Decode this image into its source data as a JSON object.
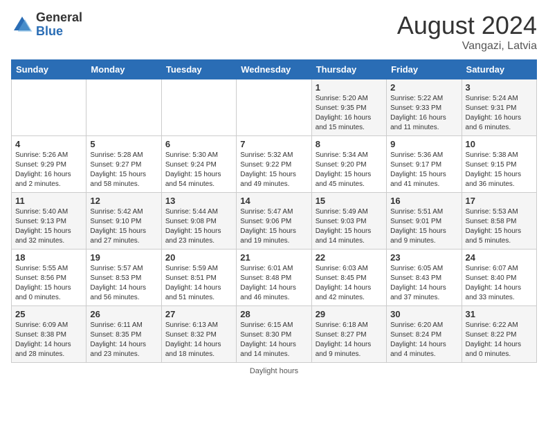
{
  "header": {
    "logo_general": "General",
    "logo_blue": "Blue",
    "month_year": "August 2024",
    "location": "Vangazi, Latvia"
  },
  "footer": {
    "note": "Daylight hours"
  },
  "days_of_week": [
    "Sunday",
    "Monday",
    "Tuesday",
    "Wednesday",
    "Thursday",
    "Friday",
    "Saturday"
  ],
  "weeks": [
    [
      {
        "day": "",
        "sunrise": "",
        "sunset": "",
        "daylight": ""
      },
      {
        "day": "",
        "sunrise": "",
        "sunset": "",
        "daylight": ""
      },
      {
        "day": "",
        "sunrise": "",
        "sunset": "",
        "daylight": ""
      },
      {
        "day": "",
        "sunrise": "",
        "sunset": "",
        "daylight": ""
      },
      {
        "day": "1",
        "sunrise": "5:20 AM",
        "sunset": "9:35 PM",
        "daylight": "16 hours and 15 minutes."
      },
      {
        "day": "2",
        "sunrise": "5:22 AM",
        "sunset": "9:33 PM",
        "daylight": "16 hours and 11 minutes."
      },
      {
        "day": "3",
        "sunrise": "5:24 AM",
        "sunset": "9:31 PM",
        "daylight": "16 hours and 6 minutes."
      }
    ],
    [
      {
        "day": "4",
        "sunrise": "5:26 AM",
        "sunset": "9:29 PM",
        "daylight": "16 hours and 2 minutes."
      },
      {
        "day": "5",
        "sunrise": "5:28 AM",
        "sunset": "9:27 PM",
        "daylight": "15 hours and 58 minutes."
      },
      {
        "day": "6",
        "sunrise": "5:30 AM",
        "sunset": "9:24 PM",
        "daylight": "15 hours and 54 minutes."
      },
      {
        "day": "7",
        "sunrise": "5:32 AM",
        "sunset": "9:22 PM",
        "daylight": "15 hours and 49 minutes."
      },
      {
        "day": "8",
        "sunrise": "5:34 AM",
        "sunset": "9:20 PM",
        "daylight": "15 hours and 45 minutes."
      },
      {
        "day": "9",
        "sunrise": "5:36 AM",
        "sunset": "9:17 PM",
        "daylight": "15 hours and 41 minutes."
      },
      {
        "day": "10",
        "sunrise": "5:38 AM",
        "sunset": "9:15 PM",
        "daylight": "15 hours and 36 minutes."
      }
    ],
    [
      {
        "day": "11",
        "sunrise": "5:40 AM",
        "sunset": "9:13 PM",
        "daylight": "15 hours and 32 minutes."
      },
      {
        "day": "12",
        "sunrise": "5:42 AM",
        "sunset": "9:10 PM",
        "daylight": "15 hours and 27 minutes."
      },
      {
        "day": "13",
        "sunrise": "5:44 AM",
        "sunset": "9:08 PM",
        "daylight": "15 hours and 23 minutes."
      },
      {
        "day": "14",
        "sunrise": "5:47 AM",
        "sunset": "9:06 PM",
        "daylight": "15 hours and 19 minutes."
      },
      {
        "day": "15",
        "sunrise": "5:49 AM",
        "sunset": "9:03 PM",
        "daylight": "15 hours and 14 minutes."
      },
      {
        "day": "16",
        "sunrise": "5:51 AM",
        "sunset": "9:01 PM",
        "daylight": "15 hours and 9 minutes."
      },
      {
        "day": "17",
        "sunrise": "5:53 AM",
        "sunset": "8:58 PM",
        "daylight": "15 hours and 5 minutes."
      }
    ],
    [
      {
        "day": "18",
        "sunrise": "5:55 AM",
        "sunset": "8:56 PM",
        "daylight": "15 hours and 0 minutes."
      },
      {
        "day": "19",
        "sunrise": "5:57 AM",
        "sunset": "8:53 PM",
        "daylight": "14 hours and 56 minutes."
      },
      {
        "day": "20",
        "sunrise": "5:59 AM",
        "sunset": "8:51 PM",
        "daylight": "14 hours and 51 minutes."
      },
      {
        "day": "21",
        "sunrise": "6:01 AM",
        "sunset": "8:48 PM",
        "daylight": "14 hours and 46 minutes."
      },
      {
        "day": "22",
        "sunrise": "6:03 AM",
        "sunset": "8:45 PM",
        "daylight": "14 hours and 42 minutes."
      },
      {
        "day": "23",
        "sunrise": "6:05 AM",
        "sunset": "8:43 PM",
        "daylight": "14 hours and 37 minutes."
      },
      {
        "day": "24",
        "sunrise": "6:07 AM",
        "sunset": "8:40 PM",
        "daylight": "14 hours and 33 minutes."
      }
    ],
    [
      {
        "day": "25",
        "sunrise": "6:09 AM",
        "sunset": "8:38 PM",
        "daylight": "14 hours and 28 minutes."
      },
      {
        "day": "26",
        "sunrise": "6:11 AM",
        "sunset": "8:35 PM",
        "daylight": "14 hours and 23 minutes."
      },
      {
        "day": "27",
        "sunrise": "6:13 AM",
        "sunset": "8:32 PM",
        "daylight": "14 hours and 18 minutes."
      },
      {
        "day": "28",
        "sunrise": "6:15 AM",
        "sunset": "8:30 PM",
        "daylight": "14 hours and 14 minutes."
      },
      {
        "day": "29",
        "sunrise": "6:18 AM",
        "sunset": "8:27 PM",
        "daylight": "14 hours and 9 minutes."
      },
      {
        "day": "30",
        "sunrise": "6:20 AM",
        "sunset": "8:24 PM",
        "daylight": "14 hours and 4 minutes."
      },
      {
        "day": "31",
        "sunrise": "6:22 AM",
        "sunset": "8:22 PM",
        "daylight": "14 hours and 0 minutes."
      }
    ]
  ]
}
